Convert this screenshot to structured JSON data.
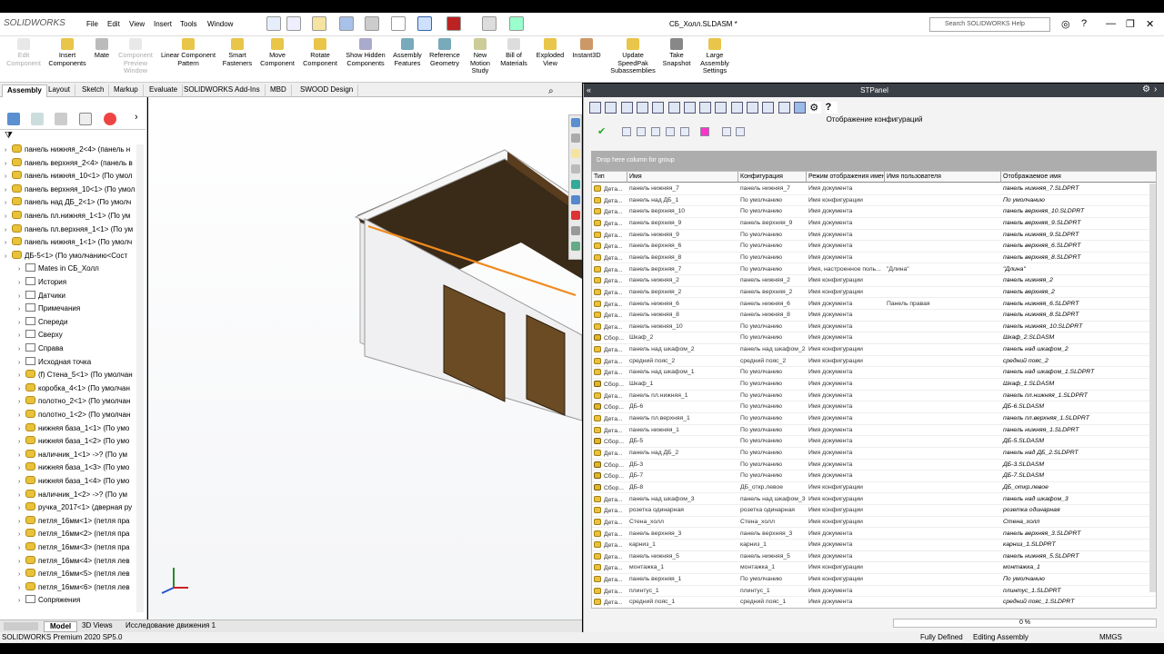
{
  "app": {
    "logo": "SOLIDWORKS",
    "doc_title": "СБ_Холл.SLDASM *",
    "search_placeholder": "Search SOLIDWORKS Help"
  },
  "menu": [
    "File",
    "Edit",
    "View",
    "Insert",
    "Tools",
    "Window"
  ],
  "ribbon": [
    {
      "label": "Edit Component",
      "disabled": true
    },
    {
      "label": "Insert Components",
      "disabled": false
    },
    {
      "label": "Mate",
      "disabled": false
    },
    {
      "label": "Component Preview Window",
      "disabled": true
    },
    {
      "label": "Linear Component Pattern",
      "disabled": false
    },
    {
      "label": "Smart Fasteners",
      "disabled": false
    },
    {
      "label": "Move Component",
      "disabled": false
    },
    {
      "label": "Rotate Component",
      "disabled": false
    },
    {
      "label": "Show Hidden Components",
      "disabled": false
    },
    {
      "label": "Assembly Features",
      "disabled": false
    },
    {
      "label": "Reference Geometry",
      "disabled": false
    },
    {
      "label": "New Motion Study",
      "disabled": false
    },
    {
      "label": "Bill of Materials",
      "disabled": false
    },
    {
      "label": "Exploded View",
      "disabled": false
    },
    {
      "label": "Instant3D",
      "disabled": false
    },
    {
      "label": "Update SpeedPak Subassemblies",
      "disabled": false
    },
    {
      "label": "Take Snapshot",
      "disabled": false
    },
    {
      "label": "Large Assembly Settings",
      "disabled": false
    }
  ],
  "tabs": [
    "Assembly",
    "Layout",
    "Sketch",
    "Markup",
    "Evaluate",
    "SOLIDWORKS Add-Ins",
    "MBD",
    "SWOOD Design"
  ],
  "tree": [
    {
      "t": "панель нижняя_2<4> (панель н",
      "lvl": 0,
      "icon": "part"
    },
    {
      "t": "панель верхняя_2<4> (панель в",
      "lvl": 0,
      "icon": "part"
    },
    {
      "t": "панель нижняя_10<1> (По умол",
      "lvl": 0,
      "icon": "part"
    },
    {
      "t": "панель верхняя_10<1> (По умол",
      "lvl": 0,
      "icon": "part"
    },
    {
      "t": "панель над ДБ_2<1> (По умолч",
      "lvl": 0,
      "icon": "part"
    },
    {
      "t": "панель пл.нижняя_1<1> (По ум",
      "lvl": 0,
      "icon": "part"
    },
    {
      "t": "панель пл.верхняя_1<1> (По ум",
      "lvl": 0,
      "icon": "part"
    },
    {
      "t": "панель нижняя_1<1> (По умолч",
      "lvl": 0,
      "icon": "part"
    },
    {
      "t": "ДБ-5<1> (По умолчанию<Сост",
      "lvl": 0,
      "icon": "part"
    },
    {
      "t": "Mates in СБ_Холл",
      "lvl": 1,
      "icon": "folder"
    },
    {
      "t": "История",
      "lvl": 1,
      "icon": "folder"
    },
    {
      "t": "Датчики",
      "lvl": 1,
      "icon": "folder"
    },
    {
      "t": "Примечания",
      "lvl": 1,
      "icon": "folder"
    },
    {
      "t": "Спереди",
      "lvl": 1,
      "icon": "folder"
    },
    {
      "t": "Сверху",
      "lvl": 1,
      "icon": "folder"
    },
    {
      "t": "Справа",
      "lvl": 1,
      "icon": "folder"
    },
    {
      "t": "Исходная точка",
      "lvl": 1,
      "icon": "folder"
    },
    {
      "t": "(f) Стена_5<1> (По умолчан",
      "lvl": 1,
      "icon": "part"
    },
    {
      "t": "коробка_4<1> (По умолчан",
      "lvl": 1,
      "icon": "part"
    },
    {
      "t": "полотно_2<1> (По умолчан",
      "lvl": 1,
      "icon": "part"
    },
    {
      "t": "полотно_1<2> (По умолчан",
      "lvl": 1,
      "icon": "part"
    },
    {
      "t": "нижняя база_1<1> (По умо",
      "lvl": 1,
      "icon": "part"
    },
    {
      "t": "нижняя база_1<2> (По умо",
      "lvl": 1,
      "icon": "part"
    },
    {
      "t": "наличник_1<1> ->? (По ум",
      "lvl": 1,
      "icon": "part"
    },
    {
      "t": "нижняя база_1<3> (По умо",
      "lvl": 1,
      "icon": "part"
    },
    {
      "t": "нижняя база_1<4> (По умо",
      "lvl": 1,
      "icon": "part"
    },
    {
      "t": "наличник_1<2> ->? (По ум",
      "lvl": 1,
      "icon": "part"
    },
    {
      "t": "ручка_2017<1> (дверная ру",
      "lvl": 1,
      "icon": "part"
    },
    {
      "t": "петля_16мм<1> (петля пра",
      "lvl": 1,
      "icon": "part"
    },
    {
      "t": "петля_16мм<2> (петля пра",
      "lvl": 1,
      "icon": "part"
    },
    {
      "t": "петля_16мм<3> (петля пра",
      "lvl": 1,
      "icon": "part"
    },
    {
      "t": "петля_16мм<4> (петля лев",
      "lvl": 1,
      "icon": "part"
    },
    {
      "t": "петля_16мм<5> (петля лев",
      "lvl": 1,
      "icon": "part"
    },
    {
      "t": "петля_16мм<6> (петля лев",
      "lvl": 1,
      "icon": "part"
    },
    {
      "t": "Сопряжения",
      "lvl": 1,
      "icon": "folder"
    }
  ],
  "bottom_tabs": [
    "Model",
    "3D Views",
    "Исследование движения 1"
  ],
  "status": {
    "left": "SOLIDWORKS Premium 2020 SP5.0",
    "defined": "Fully Defined",
    "mode": "Editing Assembly",
    "units": "MMGS"
  },
  "stpanel": {
    "title": "STPanel",
    "subtitle": "Отображение конфигураций",
    "group_hint": "Drop here column for group",
    "progress": "0 %",
    "columns": [
      "Тип",
      "Имя",
      "Конфигурация",
      "Режим отображения имени",
      "Имя пользователя",
      "Отображаемое имя"
    ],
    "rows": [
      [
        "Дета...",
        "панель нижняя_7",
        "панель нижняя_7",
        "Имя документа",
        "",
        "панель нижняя_7.SLDPRT"
      ],
      [
        "Дета...",
        "панель над ДБ_1",
        "По умолчанию",
        "Имя конфигурации",
        "",
        "По умолчанию"
      ],
      [
        "Дета...",
        "панель верхняя_10",
        "По умолчанию",
        "Имя документа",
        "",
        "панель верхняя_10.SLDPRT"
      ],
      [
        "Дета...",
        "панель верхняя_9",
        "панель верхняя_9",
        "Имя документа",
        "",
        "панель верхняя_9.SLDPRT"
      ],
      [
        "Дета...",
        "панель нижняя_9",
        "По умолчанию",
        "Имя документа",
        "",
        "панель нижняя_9.SLDPRT"
      ],
      [
        "Дета...",
        "панель верхняя_6",
        "По умолчанию",
        "Имя документа",
        "",
        "панель верхняя_6.SLDPRT"
      ],
      [
        "Дета...",
        "панель верхняя_8",
        "По умолчанию",
        "Имя документа",
        "",
        "панель верхняя_8.SLDPRT"
      ],
      [
        "Дета...",
        "панель верхняя_7",
        "По умолчанию",
        "Имя, настроенное поль...",
        "\"Длина\"",
        "\"Длина\""
      ],
      [
        "Дета...",
        "панель нижняя_2",
        "панель нижняя_2",
        "Имя конфигурации",
        "",
        "панель нижняя_2"
      ],
      [
        "Дета...",
        "панель верхняя_2",
        "панель верхняя_2",
        "Имя конфигурации",
        "",
        "панель верхняя_2"
      ],
      [
        "Дета...",
        "панель нижняя_6",
        "панель нижняя_6",
        "Имя документа",
        "Панель правая",
        "панель нижняя_6.SLDPRT"
      ],
      [
        "Дета...",
        "панель нижняя_8",
        "панель нижняя_8",
        "Имя документа",
        "",
        "панель нижняя_8.SLDPRT"
      ],
      [
        "Дета...",
        "панель нижняя_10",
        "По умолчанию",
        "Имя документа",
        "",
        "панель нижняя_10.SLDPRT"
      ],
      [
        "Сбор...",
        "Шкаф_2",
        "По умолчанию",
        "Имя документа",
        "",
        "Шкаф_2.SLDASM"
      ],
      [
        "Дета...",
        "панель над шкафом_2",
        "панель над шкафом_2",
        "Имя конфигурации",
        "",
        "панель над шкафом_2"
      ],
      [
        "Дета...",
        "средний пояс_2",
        "средний пояс_2",
        "Имя конфигурации",
        "",
        "средний пояс_2"
      ],
      [
        "Дета...",
        "панель над шкафом_1",
        "По умолчанию",
        "Имя документа",
        "",
        "панель над шкафом_1.SLDPRT"
      ],
      [
        "Сбор...",
        "Шкаф_1",
        "По умолчанию",
        "Имя документа",
        "",
        "Шкаф_1.SLDASM"
      ],
      [
        "Дета...",
        "панель пл.нижняя_1",
        "По умолчанию",
        "Имя документа",
        "",
        "панель пл.нижняя_1.SLDPRT"
      ],
      [
        "Сбор...",
        "ДБ-6",
        "По умолчанию",
        "Имя документа",
        "",
        "ДБ-6.SLDASM"
      ],
      [
        "Дета...",
        "панель пл.верхняя_1",
        "По умолчанию",
        "Имя документа",
        "",
        "панель пл.верхняя_1.SLDPRT"
      ],
      [
        "Дета...",
        "панель нижняя_1",
        "По умолчанию",
        "Имя документа",
        "",
        "панель нижняя_1.SLDPRT"
      ],
      [
        "Сбор...",
        "ДБ-5",
        "По умолчанию",
        "Имя документа",
        "",
        "ДБ-5.SLDASM"
      ],
      [
        "Дета...",
        "панель над ДБ_2",
        "По умолчанию",
        "Имя документа",
        "",
        "панель над ДБ_2.SLDPRT"
      ],
      [
        "Сбор...",
        "ДБ-3",
        "По умолчанию",
        "Имя документа",
        "",
        "ДБ-3.SLDASM"
      ],
      [
        "Сбор...",
        "ДБ-7",
        "По умолчанию",
        "Имя документа",
        "",
        "ДБ-7.SLDASM"
      ],
      [
        "Сбор...",
        "ДБ-8",
        "ДБ_откр.левое",
        "Имя конфигурации",
        "",
        "ДБ_откр.левое"
      ],
      [
        "Дета...",
        "панель над шкафом_3",
        "панель над шкафом_3",
        "Имя конфигурации",
        "",
        "панель над шкафом_3"
      ],
      [
        "Дета...",
        "розетка одинарная",
        "розетка одинарная",
        "Имя конфигурации",
        "",
        "розетка одинарная"
      ],
      [
        "Дета...",
        "Стена_холл",
        "Стена_холл",
        "Имя конфигурации",
        "",
        "Стена_холл"
      ],
      [
        "Дета...",
        "панель верхняя_3",
        "панель верхняя_3",
        "Имя документа",
        "",
        "панель верхняя_3.SLDPRT"
      ],
      [
        "Дета...",
        "карниз_1",
        "карниз_1",
        "Имя документа",
        "",
        "карниз_1.SLDPRT"
      ],
      [
        "Дета...",
        "панель нижняя_5",
        "панель нижняя_5",
        "Имя документа",
        "",
        "панель нижняя_5.SLDPRT"
      ],
      [
        "Дета...",
        "монтажка_1",
        "монтажка_1",
        "Имя конфигурации",
        "",
        "монтажка_1"
      ],
      [
        "Дета...",
        "панель верхняя_1",
        "По умолчанию",
        "Имя конфигурации",
        "",
        "По умолчанию"
      ],
      [
        "Дета...",
        "плинтус_1",
        "плинтус_1",
        "Имя документа",
        "",
        "плинтус_1.SLDPRT"
      ],
      [
        "Дета...",
        "средний пояс_1",
        "средний пояс_1",
        "Имя документа",
        "",
        "средний пояс_1.SLDPRT"
      ]
    ]
  }
}
